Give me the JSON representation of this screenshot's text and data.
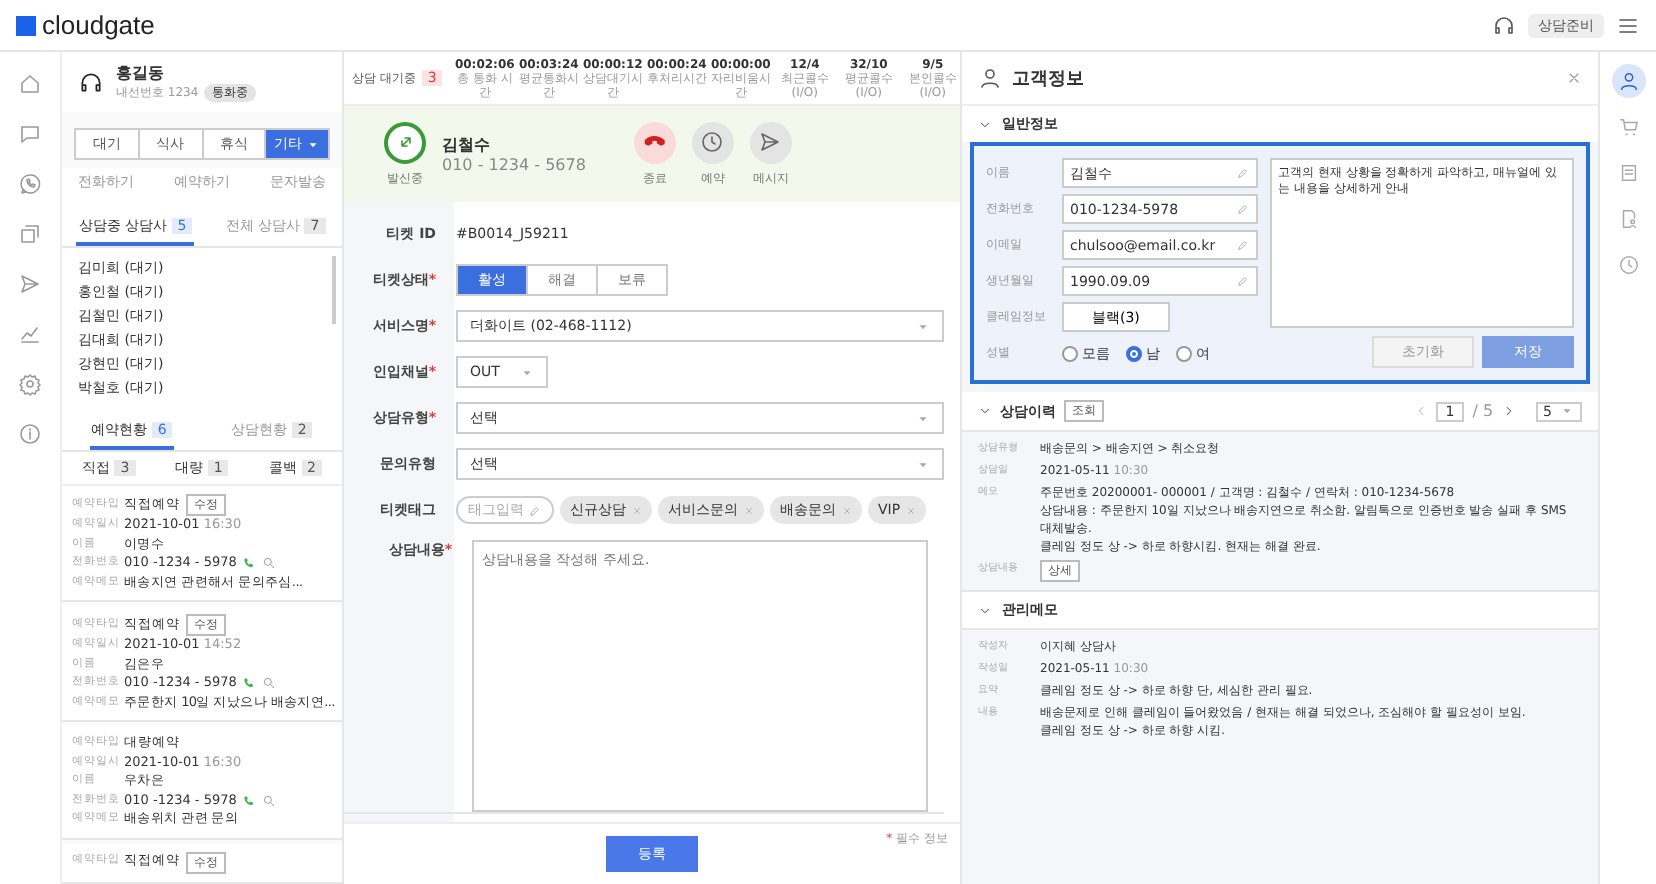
{
  "topbar": {
    "logo": "cloudgate",
    "status": "상담준비"
  },
  "agent": {
    "name": "홍길동",
    "extension": "내선번호 1234",
    "badge": "통화중"
  },
  "status_buttons": [
    {
      "label": "대기",
      "selected": false
    },
    {
      "label": "식사",
      "selected": false
    },
    {
      "label": "휴식",
      "selected": false
    },
    {
      "label": "기타",
      "selected": true
    }
  ],
  "actions": [
    "전화하기",
    "예약하기",
    "문자발송"
  ],
  "agent_tabs": [
    {
      "label": "상담중 상담사",
      "count": "5",
      "selected": true
    },
    {
      "label": "전체 상담사",
      "count": "7",
      "selected": false
    }
  ],
  "agents": [
    "김미희 (대기)",
    "홍인철 (대기)",
    "김철민 (대기)",
    "김대희 (대기)",
    "강현민 (대기)",
    "박철호 (대기)"
  ],
  "reservation_tabs": [
    {
      "label": "예약현황",
      "count": "6",
      "selected": true
    },
    {
      "label": "상담현황",
      "count": "2",
      "selected": false
    }
  ],
  "reservation_filters": [
    {
      "label": "직접",
      "count": "3"
    },
    {
      "label": "대량",
      "count": "1"
    },
    {
      "label": "콜백",
      "count": "2"
    }
  ],
  "reservations": [
    {
      "fields": [
        {
          "kind": "type",
          "label": "예약타입",
          "value": "직접예약",
          "edit": "수정"
        },
        {
          "kind": "date",
          "label": "예약일시",
          "value": "2021-10-01",
          "time": "16:30"
        },
        {
          "kind": "text",
          "label": "이름",
          "value": "이명수"
        },
        {
          "kind": "phone",
          "label": "전화번호",
          "value": "010 -1234 - 5978"
        },
        {
          "kind": "text",
          "label": "예약메모",
          "value": "배송지연 관련해서 문의주심..."
        }
      ]
    },
    {
      "fields": [
        {
          "kind": "type",
          "label": "예약타입",
          "value": "직접예약",
          "edit": "수정"
        },
        {
          "kind": "date",
          "label": "예약일시",
          "value": "2021-10-01",
          "time": "14:52"
        },
        {
          "kind": "text",
          "label": "이름",
          "value": "김은우"
        },
        {
          "kind": "phone",
          "label": "전화번호",
          "value": "010 -1234 - 5978"
        },
        {
          "kind": "text",
          "label": "예약메모",
          "value": "주문한지 10일 지났으나 배송지연..."
        }
      ]
    },
    {
      "fields": [
        {
          "kind": "type",
          "label": "예약타입",
          "value": "대량예약"
        },
        {
          "kind": "date",
          "label": "예약일시",
          "value": "2021-10-01",
          "time": "16:30"
        },
        {
          "kind": "text",
          "label": "이름",
          "value": "우차은"
        },
        {
          "kind": "phone",
          "label": "전화번호",
          "value": "010 -1234 - 5978"
        },
        {
          "kind": "text",
          "label": "예약메모",
          "value": "배송위치 관련 문의"
        }
      ]
    },
    {
      "fields": [
        {
          "kind": "type",
          "label": "예약타입",
          "value": "직접예약",
          "edit": "수정"
        }
      ]
    }
  ],
  "queue": {
    "label": "상담 대기중",
    "count": "3"
  },
  "stats": [
    {
      "value": "00:02:06",
      "label": "총 통화 시간"
    },
    {
      "value": "00:03:24",
      "label": "평균통화시간"
    },
    {
      "value": "00:00:12",
      "label": "상담대기시간"
    },
    {
      "value": "00:00:24",
      "label": "후처리시간"
    },
    {
      "value": "00:00:00",
      "label": "자리비움시간"
    },
    {
      "value": "12/4",
      "label": "최근콜수 (I/O)"
    },
    {
      "value": "32/10",
      "label": "평균콜수 (I/O)"
    },
    {
      "value": "9/5",
      "label": "본인콜수 (I/O)"
    }
  ],
  "call": {
    "status": "발신중",
    "name": "김철수",
    "phone": "010 - 1234 - 5678",
    "buttons": [
      {
        "kind": "hangup",
        "label": "종료"
      },
      {
        "kind": "reserve",
        "label": "예약"
      },
      {
        "kind": "message",
        "label": "메시지"
      }
    ]
  },
  "ticket": {
    "id_label": "티켓 ID",
    "id": "#B0014_J59211",
    "status_label": "티켓상태",
    "status_required_mark": "*",
    "statuses": [
      {
        "label": "활성",
        "selected": true
      },
      {
        "label": "해결",
        "selected": false
      },
      {
        "label": "보류",
        "selected": false
      }
    ],
    "selects": [
      {
        "label": "서비스명",
        "required_mark": "*",
        "value": "더화이트 (02-468-1112)",
        "kind": "wide"
      },
      {
        "label": "인입채널",
        "required_mark": "*",
        "value": "OUT",
        "kind": "compact"
      },
      {
        "label": "상담유형",
        "required_mark": "*",
        "value": "선택",
        "kind": "wide"
      },
      {
        "label": "문의유형",
        "value": "선택",
        "kind": "wide"
      }
    ],
    "tags_label": "티켓태그",
    "tag_placeholder": "태그입력",
    "tags": [
      "신규상담",
      "서비스문의",
      "배송문의",
      "VIP"
    ],
    "content_label": "상담내용",
    "content_required_mark": "*",
    "content_placeholder": "상담내용을 작성해 주세요.",
    "submit": "등록",
    "note_mark": "*",
    "required_note": "필수 정보"
  },
  "customer": {
    "title": "고객정보",
    "section": "일반정보",
    "fields": [
      {
        "label": "이름",
        "value": "김철수"
      },
      {
        "label": "전화번호",
        "value": "010-1234-5978"
      },
      {
        "label": "이메일",
        "value": "chulsoo@email.co.kr"
      },
      {
        "label": "생년월일",
        "value": "1990.09.09"
      }
    ],
    "claim_label": "클레임정보",
    "claim": "블랙(3)",
    "gender_label": "성별",
    "genders": [
      {
        "label": "모름",
        "selected": false
      },
      {
        "label": "남",
        "selected": true
      },
      {
        "label": "여",
        "selected": false
      }
    ],
    "memo": "고객의 현재 상황을 정확하게 파악하고, 매뉴얼에 있는 내용을 상세하게 안내",
    "reset": "초기화",
    "save": "저장",
    "save_disabled": true
  },
  "history": {
    "title": "상담이력",
    "search": "조회",
    "page": "1",
    "pages": "/ 5",
    "page_size": "5",
    "rows": [
      {
        "label": "상담유형",
        "lines": [
          "배송문의 > 배송지연 > 취소요청"
        ]
      },
      {
        "label": "상담일",
        "lines": [
          "2021-05-11"
        ],
        "time": "10:30"
      },
      {
        "label": "메모",
        "lines": [
          "주문번호 20200001- 000001 / 고객명 : 김철수 / 연락처 : 010-1234-5678",
          "상담내용 : 주문한지 10일 지났으나 배송지연으로 취소함. 알림톡으로 인증번호 발송 실패 후 SMS 대체발송.",
          "클레임 정도 상 -> 하로 하향시킴. 현재는 해결 완료."
        ]
      }
    ],
    "detail_label": "상담내용",
    "detail": "상세"
  },
  "memo_section": {
    "title": "관리메모",
    "rows": [
      {
        "label": "작성자",
        "lines": [
          "이지혜 상담사"
        ]
      },
      {
        "label": "작성일",
        "lines": [
          "2021-05-11"
        ],
        "time": "10:30"
      },
      {
        "label": "요약",
        "lines": [
          "클레임 정도 상 -> 하로 하향 단, 세심한 관리 필요."
        ]
      },
      {
        "label": "내용",
        "lines": [
          "배송문제로 인해 클레임이 들어왔었음 / 현재는 해결 되었으나, 조심해야 할 필요성이 보임.",
          "클레임 정도 상 -> 하로 하향 시킴."
        ]
      }
    ]
  },
  "right_rail": [
    {
      "selected": true
    },
    {
      "selected": false
    },
    {
      "selected": false
    },
    {
      "selected": false
    },
    {
      "selected": false
    }
  ]
}
